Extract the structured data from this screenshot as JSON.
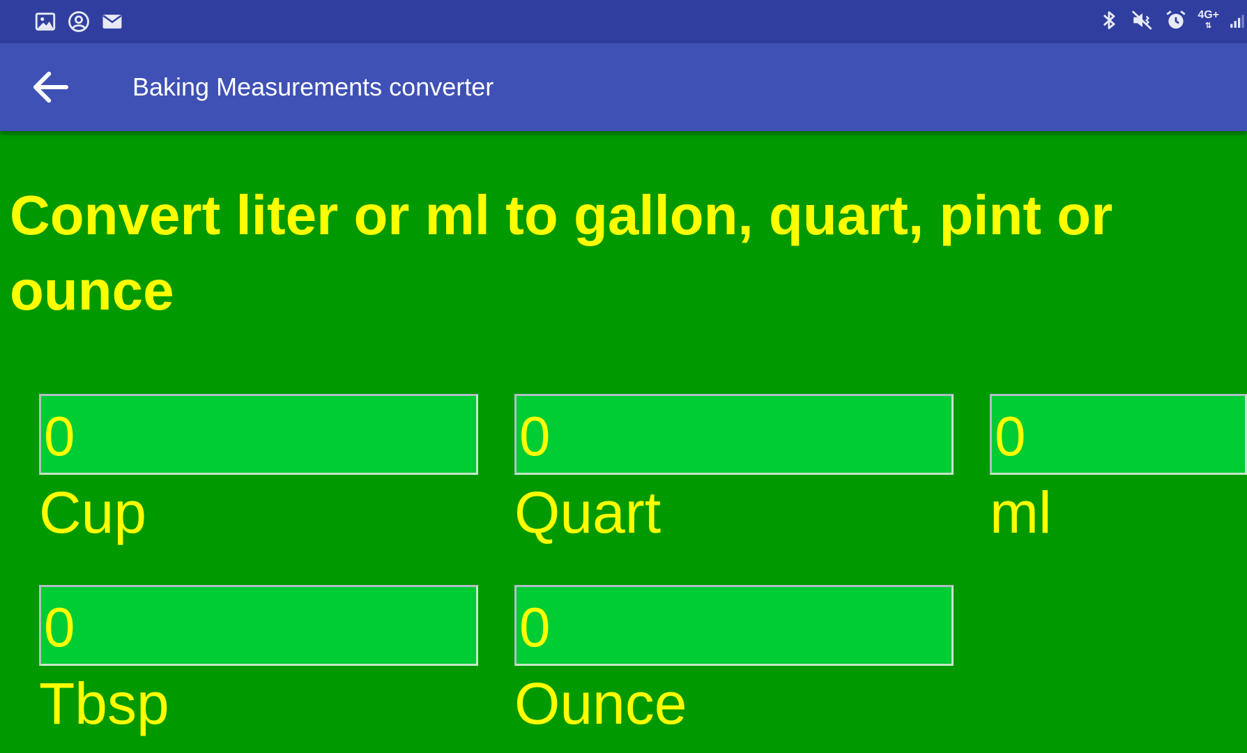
{
  "status_bar": {
    "left_icons": [
      "image-icon",
      "account-circle-icon",
      "mail-icon"
    ],
    "right_icons": [
      "bluetooth-icon",
      "vibrate-mute-icon",
      "alarm-icon"
    ],
    "network_label": "4G+",
    "signal_icon": "signal-icon"
  },
  "app_bar": {
    "back_icon": "arrow-back-icon",
    "title": "Baking Measurements converter"
  },
  "heading": "Convert liter or ml to gallon, quart, pint or ounce",
  "fields": [
    {
      "value": "0",
      "unit": "Cup"
    },
    {
      "value": "0",
      "unit": "Quart"
    },
    {
      "value": "0",
      "unit": "ml"
    },
    {
      "value": "0",
      "unit": "Tbsp"
    },
    {
      "value": "0",
      "unit": "Ounce"
    }
  ],
  "colors": {
    "status_bar": "#303f9f",
    "app_bar": "#3f51b5",
    "background": "#009900",
    "field_background": "#00cc33",
    "text": "#ffff00"
  }
}
